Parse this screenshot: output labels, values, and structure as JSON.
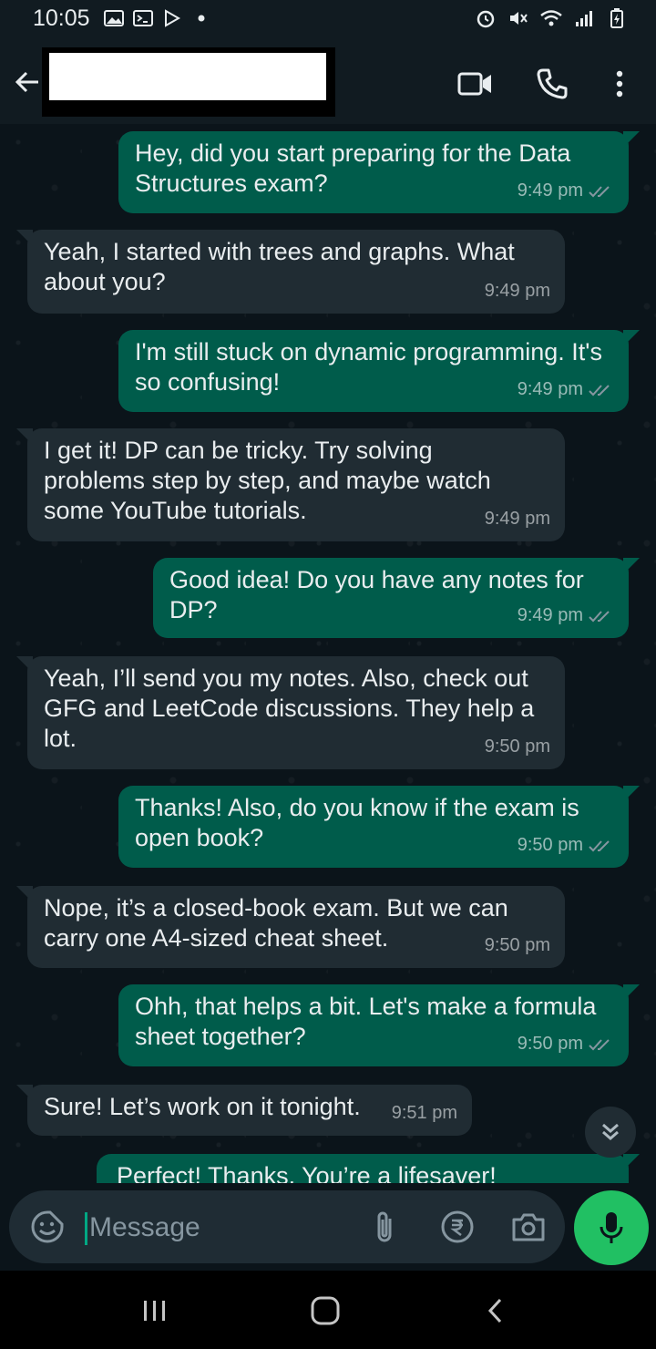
{
  "status_bar": {
    "time": "10:05"
  },
  "header": {
    "contact_name": "",
    "video_call_icon": "video-camera",
    "voice_call_icon": "phone",
    "menu_icon": "three-dots-vertical"
  },
  "messages": [
    {
      "direction": "outgoing",
      "text": "Hey, did you start preparing for the Data\nStructures exam?",
      "time": "9:49 pm",
      "status": "read"
    },
    {
      "direction": "incoming",
      "text": "Yeah, I started with trees and graphs. What\nabout you?",
      "time": "9:49 pm"
    },
    {
      "direction": "outgoing",
      "text": "I'm still stuck on dynamic programming. It's\nso confusing!",
      "time": "9:49 pm",
      "status": "read"
    },
    {
      "direction": "incoming",
      "text": "I get it! DP can be tricky. Try solving\nproblems step by step, and maybe watch\nsome YouTube tutorials.",
      "time": "9:49 pm"
    },
    {
      "direction": "outgoing",
      "text": "Good idea! Do you have any notes for DP?",
      "time": "9:49 pm",
      "status": "read"
    },
    {
      "direction": "incoming",
      "text": "Yeah, I’ll send you my notes. Also, check out\nGFG and LeetCode discussions. They help a\nlot.",
      "time": "9:50 pm"
    },
    {
      "direction": "outgoing",
      "text": "Thanks! Also, do you know if the exam is\nopen book?",
      "time": "9:50 pm",
      "status": "read"
    },
    {
      "direction": "incoming",
      "text": "Nope, it’s a closed-book exam. But we can\ncarry one A4-sized cheat sheet.",
      "time": "9:50 pm"
    },
    {
      "direction": "outgoing",
      "text": "Ohh, that helps a bit. Let's make a formula\nsheet together?",
      "time": "9:50 pm",
      "status": "read"
    },
    {
      "direction": "incoming",
      "text": "Sure! Let’s work on it tonight.",
      "time": "9:51 pm"
    },
    {
      "direction": "outgoing",
      "text": "Perfect! Thanks. You’re a lifesaver!",
      "time": "",
      "status": "read"
    }
  ],
  "composer": {
    "placeholder": "Message",
    "icons": [
      "sticker-emoji",
      "attach-paperclip",
      "rupee-payment",
      "camera",
      "microphone"
    ]
  },
  "colors": {
    "outgoing_bubble": "#005c4b",
    "incoming_bubble": "#202c33",
    "accent": "#21c063",
    "read_ticks": "#8696a0"
  }
}
